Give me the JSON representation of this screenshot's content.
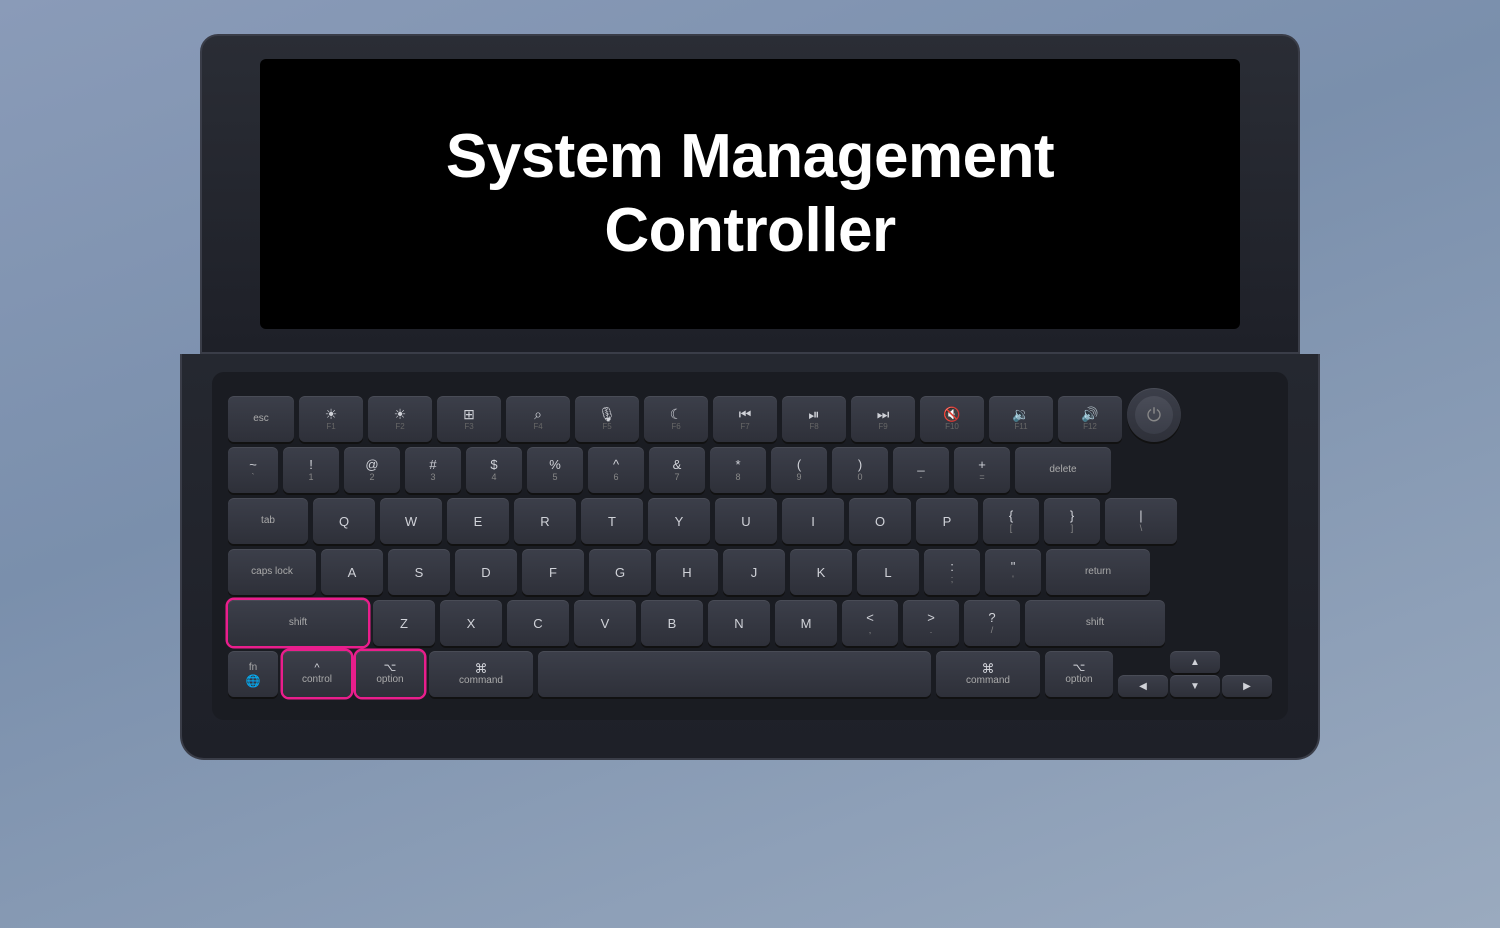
{
  "title": "System Management Controller",
  "screen": {
    "title_line1": "System Management",
    "title_line2": "Controller"
  },
  "keyboard": {
    "highlighted_keys": [
      "left-shift",
      "control",
      "left-option",
      "power"
    ],
    "rows": {
      "fn_row": {
        "esc": "esc",
        "f1": "F1",
        "f2": "F2",
        "f3": "F3",
        "f4": "F4",
        "f5": "F5",
        "f6": "F6",
        "f7": "F7",
        "f8": "F8",
        "f9": "F9",
        "f10": "F10",
        "f11": "F11",
        "f12": "F12"
      },
      "number_row": {
        "keys": [
          "~`",
          "!1",
          "@2",
          "#3",
          "$4",
          "%5",
          "^6",
          "&7",
          "*8",
          "(9",
          ")0",
          "_-",
          "+=",
          "delete"
        ]
      },
      "tab_row": {
        "keys": [
          "tab",
          "Q",
          "W",
          "E",
          "R",
          "T",
          "Y",
          "U",
          "I",
          "O",
          "P",
          "{[",
          "}]",
          "|\\"
        ]
      },
      "caps_row": {
        "keys": [
          "caps lock",
          "A",
          "S",
          "D",
          "F",
          "G",
          "H",
          "J",
          "K",
          "L",
          ":;",
          "\"'",
          "return"
        ]
      },
      "shift_row": {
        "keys": [
          "shift",
          "Z",
          "X",
          "C",
          "V",
          "B",
          "N",
          "M",
          "<,",
          ">.",
          "?/",
          "shift"
        ]
      },
      "bottom_row": {
        "keys": [
          "fn",
          "control",
          "option",
          "command",
          "space",
          "command",
          "option",
          "arrows"
        ]
      }
    }
  }
}
